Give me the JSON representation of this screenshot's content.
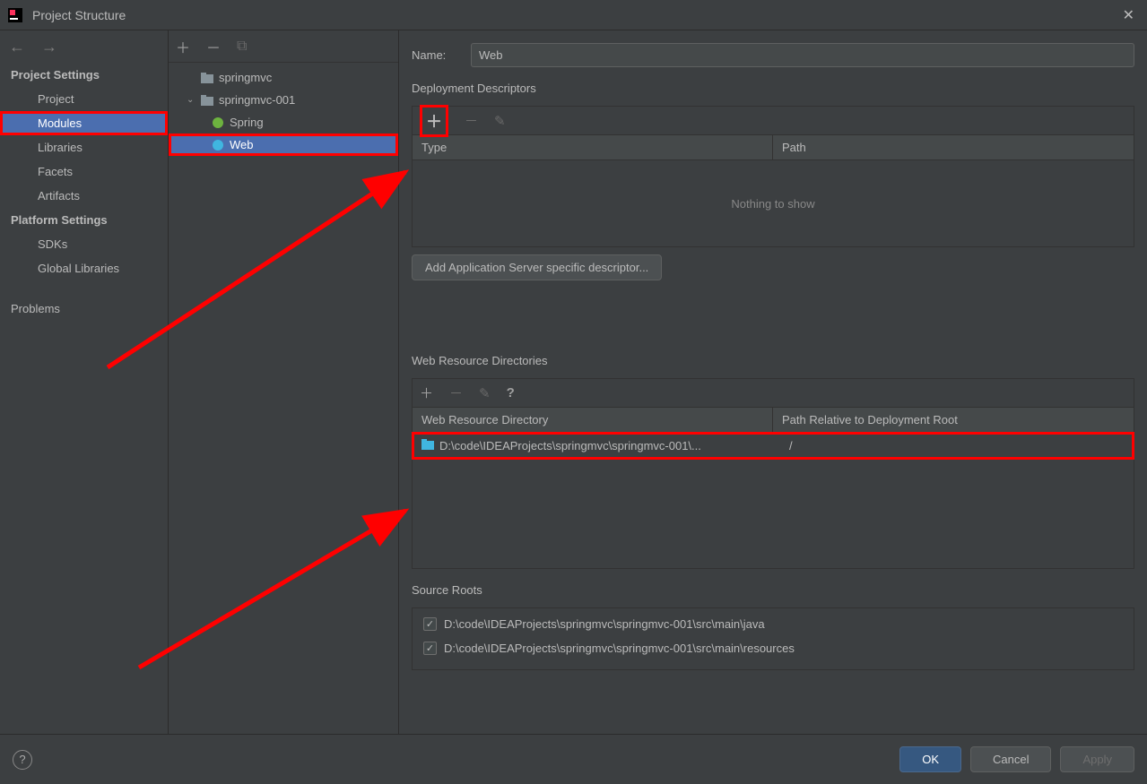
{
  "titlebar": {
    "title": "Project Structure"
  },
  "sidebar": {
    "section_project": "Project Settings",
    "items_project": [
      "Project",
      "Modules",
      "Libraries",
      "Facets",
      "Artifacts"
    ],
    "section_platform": "Platform Settings",
    "items_platform": [
      "SDKs",
      "Global Libraries"
    ],
    "item_problems": "Problems"
  },
  "tree": {
    "root": "springmvc",
    "sub": "springmvc-001",
    "spring": "Spring",
    "web": "Web"
  },
  "content": {
    "name_label": "Name:",
    "name_value": "Web",
    "dd_title": "Deployment Descriptors",
    "dd_col_type": "Type",
    "dd_col_path": "Path",
    "dd_empty": "Nothing to show",
    "dd_btn": "Add Application Server specific descriptor...",
    "wrd_title": "Web Resource Directories",
    "wrd_col1": "Web Resource Directory",
    "wrd_col2": "Path Relative to Deployment Root",
    "wrd_row_dir": "D:\\code\\IDEAProjects\\springmvc\\springmvc-001\\...",
    "wrd_row_path": "/",
    "sr_title": "Source Roots",
    "sr_rows": [
      "D:\\code\\IDEAProjects\\springmvc\\springmvc-001\\src\\main\\java",
      "D:\\code\\IDEAProjects\\springmvc\\springmvc-001\\src\\main\\resources"
    ]
  },
  "footer": {
    "ok": "OK",
    "cancel": "Cancel",
    "apply": "Apply"
  }
}
